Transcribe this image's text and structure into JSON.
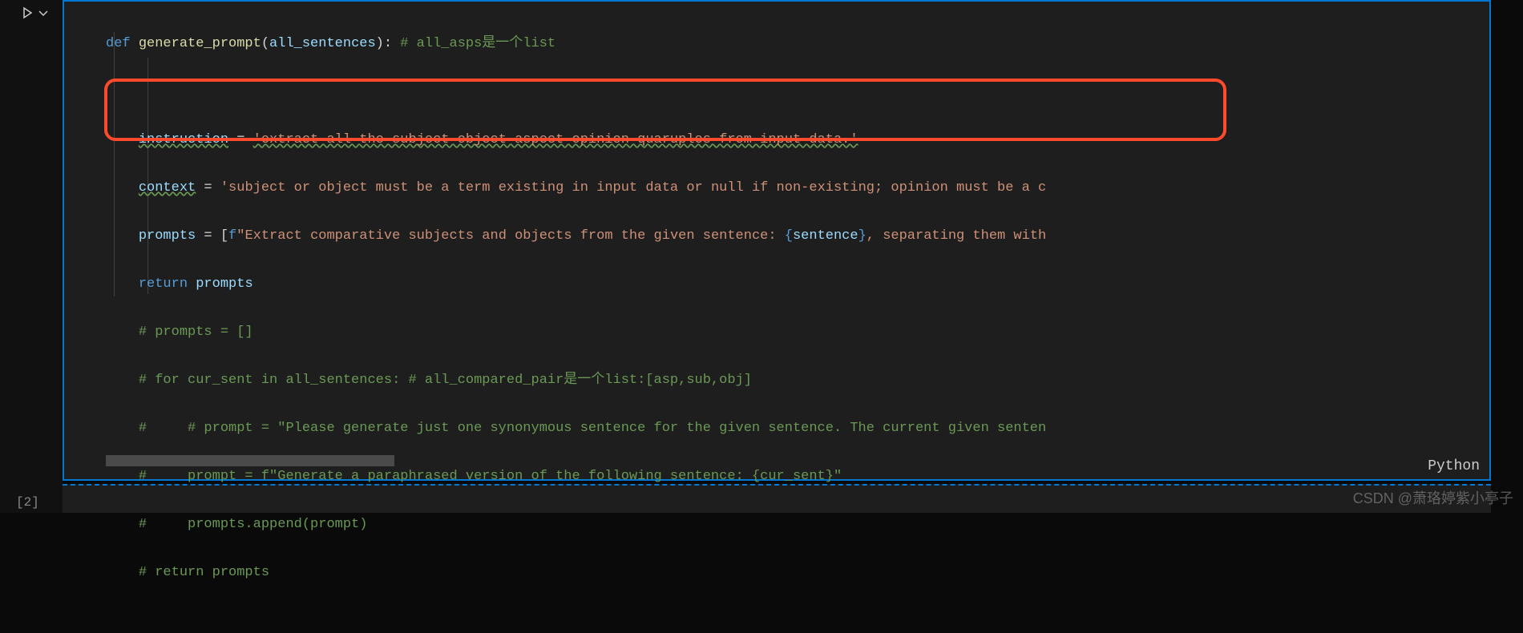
{
  "gutter": {
    "cell_label": "[2]"
  },
  "lang": "Python",
  "watermark": "CSDN @萧珞婷紫小亭子",
  "code": {
    "l1": {
      "kw": "def",
      "fn": "generate_prompt",
      "args": "all_sentences",
      "cm": "# all_asps是一个list"
    },
    "l3": {
      "var": "instruction",
      "op": " = ",
      "str": "'extract all the subject-object-aspect-opinion quaruples from input data.'"
    },
    "l4": {
      "var": "context",
      "op": " = ",
      "str": "'subject or object must be a term existing in input data or null if non-existing; opinion must be a c"
    },
    "l5": {
      "var": "prompts",
      "op": " = [",
      "fpre": "f",
      "s1": "\"Extract comparative subjects and objects from the given sentence: ",
      "b1": "{",
      "fv": "sentence",
      "b2": "}",
      "s2": ", separating them with"
    },
    "l6": {
      "kw": "return",
      "var": "prompts"
    },
    "l7": {
      "cm": "# prompts = []"
    },
    "l8": {
      "cm": "# for cur_sent in all_sentences: # all_compared_pair是一个list:[asp,sub,obj]"
    },
    "l9": {
      "cm": "#     # prompt = \"Please generate just one synonymous sentence for the given sentence. The current given senten"
    },
    "l10": {
      "cm": "#     prompt = f\"Generate a paraphrased version of the following sentence: {cur_sent}\""
    },
    "l11": {
      "cm": "#     prompts.append(prompt)"
    },
    "l12": {
      "cm": "# return prompts"
    }
  }
}
